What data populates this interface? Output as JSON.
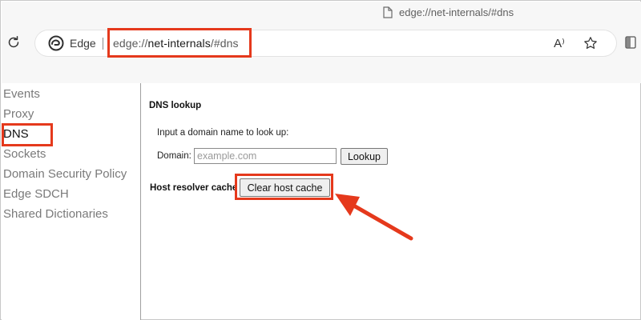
{
  "browser": {
    "tab_title": "edge://net-internals/#dns",
    "brand_label": "Edge",
    "url_scheme": "edge://",
    "url_host": "net-internals",
    "url_path": "/#dns",
    "icons": [
      "page-icon",
      "refresh-icon",
      "edge-logo-icon",
      "read-aloud-icon",
      "favorite-star-icon",
      "split-screen-icon"
    ],
    "read_aloud_glyph": "A⁾"
  },
  "sidebar": {
    "items": [
      {
        "label": "Events"
      },
      {
        "label": "Proxy"
      },
      {
        "label": "DNS"
      },
      {
        "label": "Sockets"
      },
      {
        "label": "Domain Security Policy"
      },
      {
        "label": "Edge SDCH"
      },
      {
        "label": "Shared Dictionaries"
      }
    ],
    "active": "DNS"
  },
  "main": {
    "dns_heading": "DNS lookup",
    "prompt": "Input a domain name to look up:",
    "domain_label": "Domain:",
    "domain_placeholder": "example.com",
    "lookup_button": "Lookup",
    "resolver_heading": "Host resolver cache",
    "clear_button": "Clear host cache"
  },
  "annotation_color": "#e5391c"
}
